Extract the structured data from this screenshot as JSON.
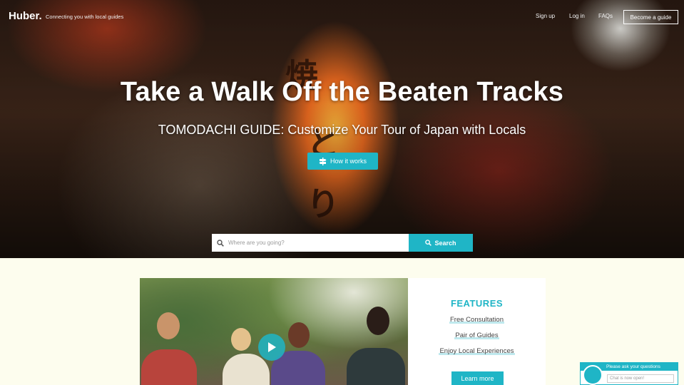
{
  "nav": {
    "logo": "Huber.",
    "tagline": "Connecting you with local guides",
    "links": [
      "Sign up",
      "Log in",
      "FAQs"
    ],
    "become_guide": "Become a guide"
  },
  "hero": {
    "title": "Take a Walk Off the Beaten Tracks",
    "subtitle": "TOMODACHI GUIDE: Customize Your Tour of Japan with Locals",
    "how_button": "How it works",
    "lantern_chars": [
      "焼",
      "と",
      "り"
    ]
  },
  "search": {
    "placeholder": "Where are you going?",
    "button": "Search"
  },
  "features": {
    "title": "FEATURES",
    "items": [
      "Free Consultation",
      "Pair of Guides",
      "Enjoy Local Experiences"
    ],
    "learn_more": "Learn more"
  },
  "chat": {
    "header": "Please ask your questions",
    "placeholder": "Chat is now open!"
  },
  "colors": {
    "accent": "#1fb5c6",
    "page_bg": "#fdfdee"
  }
}
